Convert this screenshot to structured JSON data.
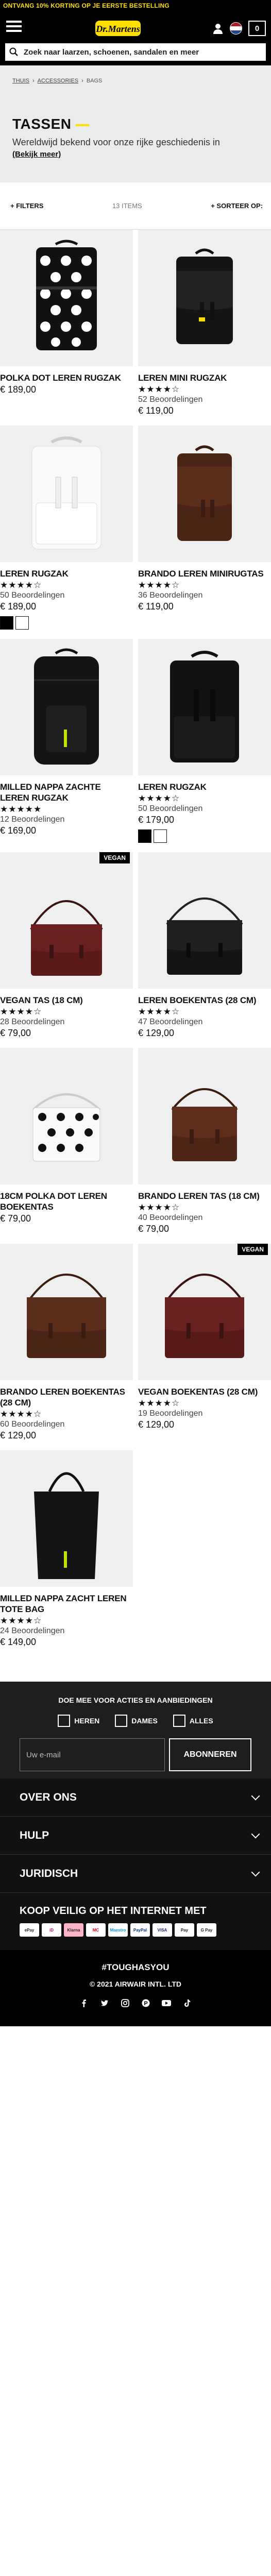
{
  "promo": "ONTVANG 10% KORTING OP JE EERSTE BESTELLING",
  "header": {
    "logo_text": "Dr. Martens",
    "cart_count": "0",
    "search_placeholder": "Zoek naar laarzen, schoenen, sandalen en meer"
  },
  "breadcrumbs": [
    "THUIS",
    "ACCESSORIES",
    "BAGS"
  ],
  "page": {
    "title": "TASSEN",
    "intro": "Wereldwijd bekend voor onze rijke geschiedenis in",
    "more": "(Bekijk meer)"
  },
  "filterbar": {
    "filters": "+ FILTERS",
    "count": "13 ITEMS",
    "sort": "+ SORTEER OP:"
  },
  "products": [
    {
      "name": "POLKA DOT LEREN RUGZAK",
      "price": "€ 189,00"
    },
    {
      "name": "LEREN MINI RUGZAK",
      "rating": 4.5,
      "stars": "★★★★☆",
      "reviews": "52 Beoordelingen",
      "price": "€ 119,00"
    },
    {
      "name": "LEREN RUGZAK",
      "rating": 4.5,
      "stars": "★★★★☆",
      "reviews": "50 Beoordelingen",
      "price": "€ 189,00",
      "swatches": [
        "#000000",
        "#ffffff"
      ]
    },
    {
      "name": "BRANDO LEREN MINIRUGTAS",
      "rating": 4.5,
      "stars": "★★★★☆",
      "reviews": "36 Beoordelingen",
      "price": "€ 119,00"
    },
    {
      "name": "MILLED NAPPA ZACHTE LEREN RUGZAK",
      "rating": 5,
      "stars": "★★★★★",
      "reviews": "12 Beoordelingen",
      "price": "€ 169,00"
    },
    {
      "name": "LEREN RUGZAK",
      "rating": 4.5,
      "stars": "★★★★☆",
      "reviews": "50 Beoordelingen",
      "price": "€ 179,00",
      "swatches": [
        "#000000",
        "#ffffff"
      ]
    },
    {
      "name": "VEGAN TAS (18 CM)",
      "rating": 4.5,
      "stars": "★★★★☆",
      "reviews": "28 Beoordelingen",
      "price": "€ 79,00",
      "badge": "VEGAN"
    },
    {
      "name": "LEREN BOEKENTAS (28 CM)",
      "rating": 4.5,
      "stars": "★★★★☆",
      "reviews": "47 Beoordelingen",
      "price": "€ 129,00"
    },
    {
      "name": "18CM POLKA DOT LEREN BOEKENTAS",
      "price": "€ 79,00"
    },
    {
      "name": "BRANDO LEREN TAS (18 CM)",
      "rating": 4.5,
      "stars": "★★★★☆",
      "reviews": "40 Beoordelingen",
      "price": "€ 79,00"
    },
    {
      "name": "BRANDO LEREN BOEKENTAS (28 CM)",
      "rating": 4.5,
      "stars": "★★★★☆",
      "reviews": "60 Beoordelingen",
      "price": "€ 129,00"
    },
    {
      "name": "VEGAN BOEKENTAS (28 CM)",
      "rating": 4.5,
      "stars": "★★★★☆",
      "reviews": "19 Beoordelingen",
      "price": "€ 129,00",
      "badge": "VEGAN"
    },
    {
      "name": "MILLED NAPPA ZACHT LEREN TOTE BAG",
      "rating": 4.5,
      "stars": "★★★★☆",
      "reviews": "24 Beoordelingen",
      "price": "€ 149,00"
    }
  ],
  "newsletter": {
    "title": "DOE MEE VOOR ACTIES EN AANBIEDINGEN",
    "options": [
      "HEREN",
      "DAMES",
      "ALLES"
    ],
    "email_placeholder": "Uw e-mail",
    "submit": "ABONNEREN"
  },
  "footer": {
    "sections": [
      "OVER ONS",
      "HULP",
      "JURIDISCH"
    ],
    "pay_title": "KOOP VEILIG OP HET INTERNET MET",
    "payment_icons": [
      "ePay",
      "iD",
      "Klarna",
      "MC",
      "Maestro",
      "PayPal",
      "VISA",
      "Pay",
      "G Pay"
    ],
    "hashtag": "#TOUGHASYOU",
    "copyright": "© 2021 AIRWAIR INTL. LTD",
    "social_icons": [
      "facebook-icon",
      "twitter-icon",
      "instagram-icon",
      "pinterest-icon",
      "youtube-icon",
      "tiktok-icon"
    ]
  },
  "colors": {
    "accent": "#ffde00",
    "header": "#000000",
    "hero": "#ebebeb"
  }
}
